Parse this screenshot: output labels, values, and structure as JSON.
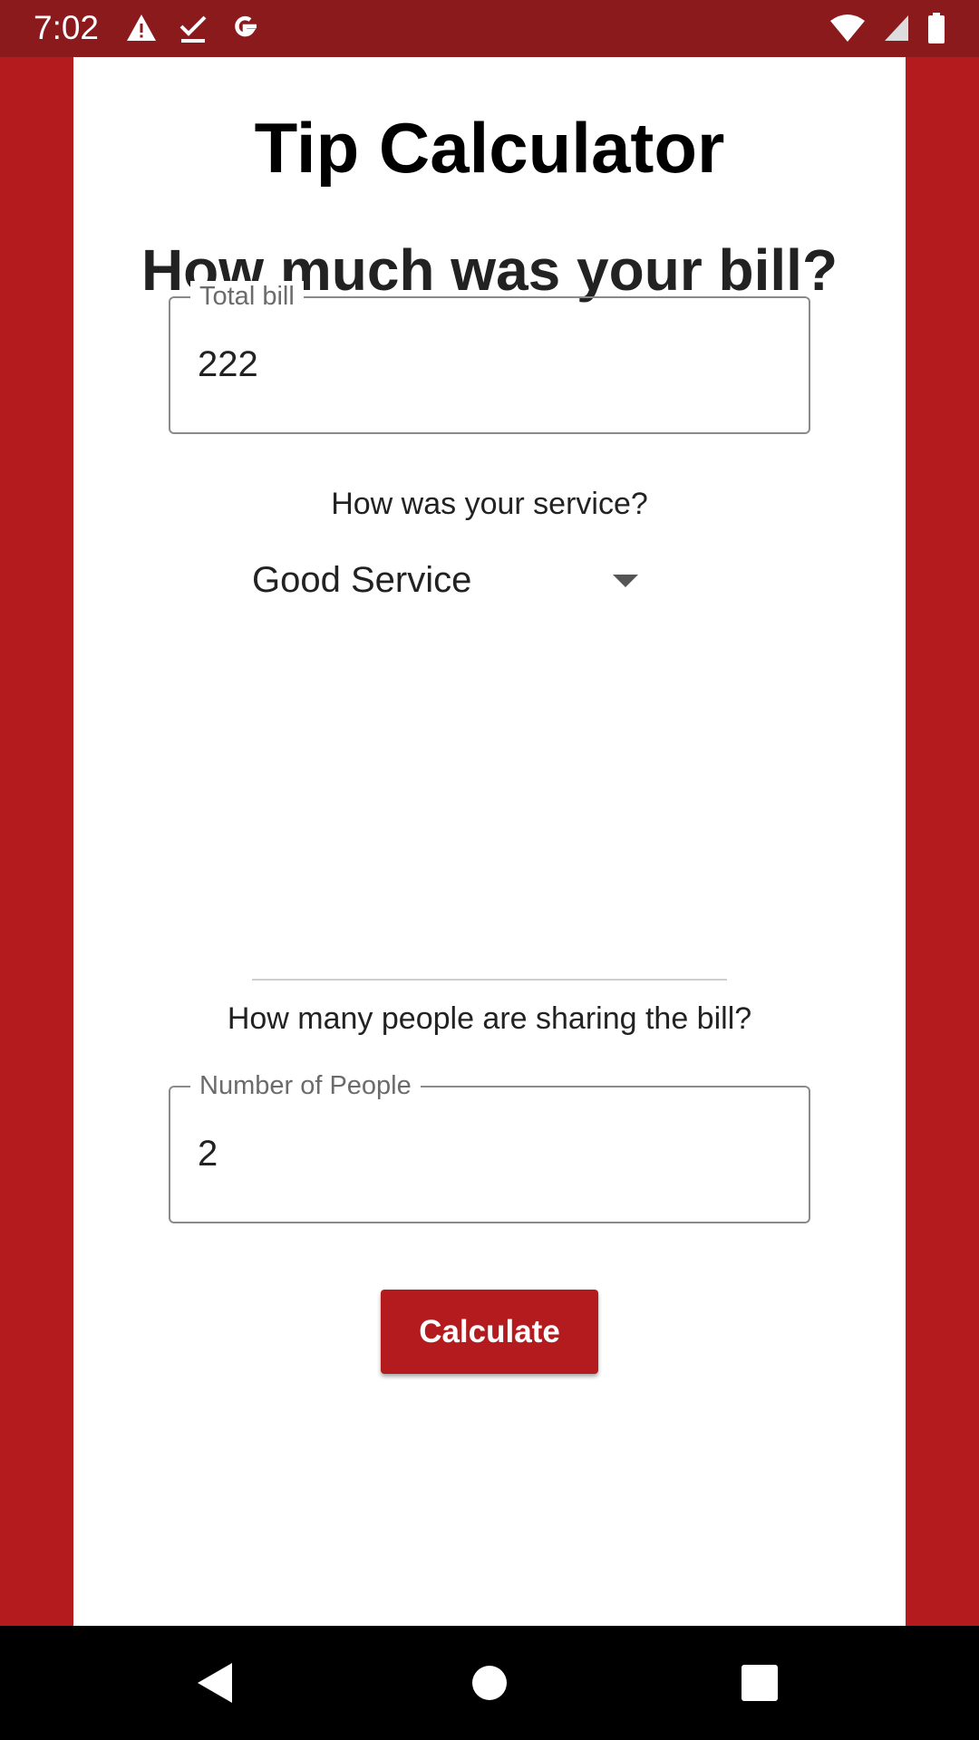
{
  "status_bar": {
    "time": "7:02",
    "left_icons": [
      "warning-icon",
      "download-done-icon",
      "google-icon"
    ],
    "right_icons": [
      "wifi-icon",
      "cell-signal-icon",
      "battery-icon"
    ]
  },
  "app": {
    "title": "Tip Calculator",
    "bill_question": "How much was your bill?",
    "total_bill": {
      "label": "Total bill",
      "value": "222"
    },
    "service_question": "How was your service?",
    "service_select": {
      "selected": "Good Service"
    },
    "people_question": "How many people are sharing the bill?",
    "people_field": {
      "label": "Number of People",
      "value": "2"
    },
    "calculate_label": "Calculate"
  },
  "colors": {
    "brand": "#b31b1e",
    "status_bar": "#8a1a1b",
    "background": "#ffffff"
  },
  "nav_bar": {
    "icons": [
      "back-icon",
      "home-icon",
      "recents-icon"
    ]
  }
}
